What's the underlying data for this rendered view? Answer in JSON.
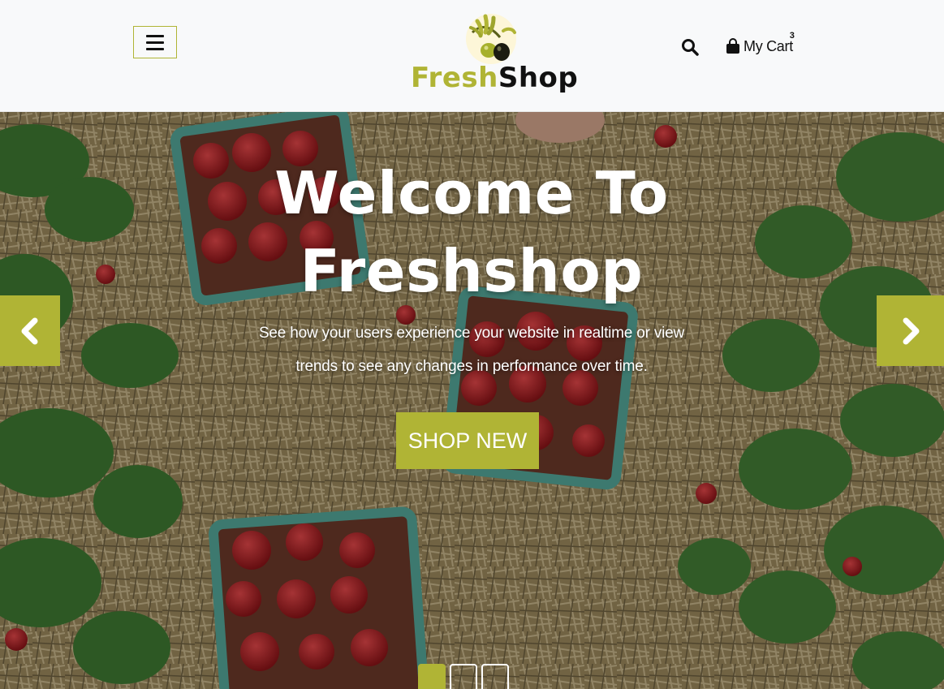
{
  "header": {
    "logo_part1": "Fresh",
    "logo_part2": "Shop",
    "cart_label": "My Cart",
    "cart_count": "3"
  },
  "hero": {
    "title_line1": "Welcome To",
    "title_line2": "Freshshop",
    "subtitle_line1": "See how your users experience your website in realtime or view",
    "subtitle_line2": "trends to see any changes in performance over time.",
    "cta_label": "SHOP NEW",
    "slides_total": 3,
    "active_slide": 1
  },
  "icons": {
    "menu": "hamburger-icon",
    "search": "search-icon",
    "cart": "shopping-bag-icon",
    "prev": "chevron-left-icon",
    "next": "chevron-right-icon"
  },
  "colors": {
    "accent": "#b0b435",
    "header_bg": "#f8f9fa",
    "text_dark": "#111111"
  }
}
